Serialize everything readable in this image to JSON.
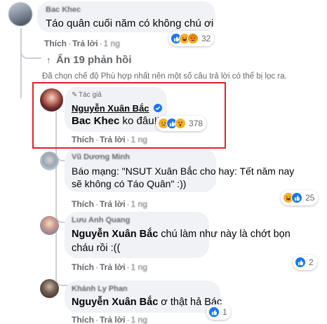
{
  "comment_top": {
    "author": "Bac Khec",
    "text": "Táo quân cuối năm có không chú ơi",
    "reactions": [
      "like",
      "haha",
      "angry"
    ],
    "reaction_count": "32",
    "like_label": "Thích",
    "reply_label": "Trả lời"
  },
  "hide_replies": {
    "label": "Ẩn 19 phản hồi"
  },
  "filter_notice": "Đã chọn chế độ Phù hợp nhất nên một số câu trả lời có thể bị lọc ra.",
  "reply_author": {
    "badge": "Tác giả",
    "author": "Nguyễn Xuân Bắc",
    "mention": "Bac Khec",
    "text": " ko đâu!!!",
    "reactions": [
      "sad",
      "like",
      "wow"
    ],
    "reaction_count": "378",
    "like_label": "Thích",
    "reply_label": "Trả lời",
    "highlight_color": "#e4202e"
  },
  "reply_2": {
    "author": "Vũ Dương Minh",
    "line1": "Báo mạng: \"NSUT Xuân Bắc cho hay: Tết năm nay",
    "line2": "sẽ không có Táo Quân\" :))",
    "reactions": [
      "haha",
      "like"
    ],
    "reaction_count": "25",
    "like_label": "Thích",
    "reply_label": "Trả lời"
  },
  "reply_3": {
    "author": "Lưu Anh Quang",
    "mention": "Nguyễn Xuân Bắc",
    "line1": " chú làm như này là chớt bọn",
    "line2": "cháu rồi :((",
    "reactions": [
      "like"
    ],
    "reaction_count": "2",
    "like_label": "Thích",
    "reply_label": "Trả lời"
  },
  "reply_4": {
    "author": "Khánh Ly Phan",
    "mention": "Nguyễn Xuân Bắc",
    "text": " ơ thật hả Bác",
    "reactions": [
      "like"
    ],
    "reaction_count": "1",
    "like_label": "Thích",
    "reply_label": "Trả lời"
  },
  "colors": {
    "like_blue": "#1877f2",
    "haha_yellow": "#f7b125",
    "angry_orange": "#e9710f",
    "verified_blue": "#1877f2"
  }
}
